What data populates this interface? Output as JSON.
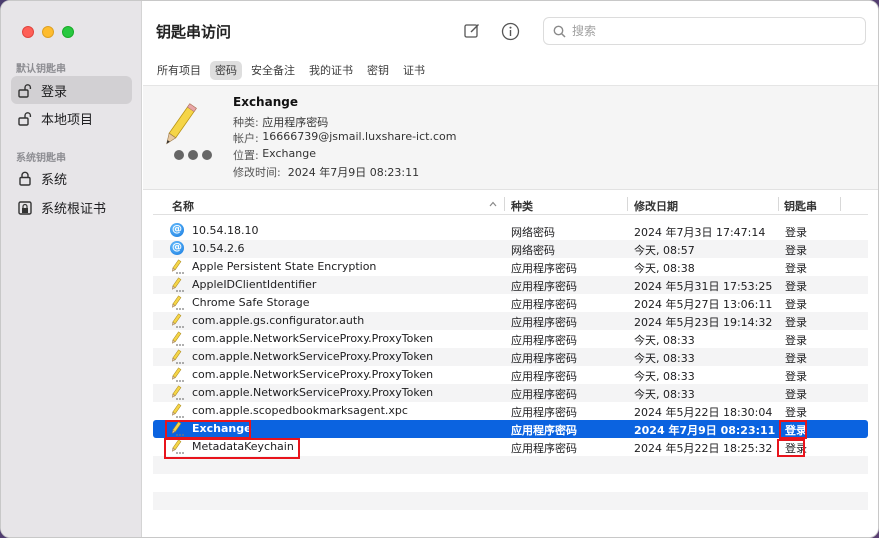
{
  "window": {
    "title": "钥匙串访问",
    "search_placeholder": "搜索"
  },
  "sidebar": {
    "section_default": "默认钥匙串",
    "section_system": "系统钥匙串",
    "items": [
      {
        "label": "登录",
        "icon": "unlock-icon"
      },
      {
        "label": "本地项目",
        "icon": "unlock-icon"
      },
      {
        "label": "系统",
        "icon": "lock-icon"
      },
      {
        "label": "系统根证书",
        "icon": "certificate-lock-icon"
      }
    ]
  },
  "tabs": [
    "所有项目",
    "密码",
    "安全备注",
    "我的证书",
    "密钥",
    "证书"
  ],
  "detail": {
    "name": "Exchange",
    "kind_label": "种类:",
    "kind": "应用程序密码",
    "account_label": "帐户:",
    "account": "16666739@jsmail.luxshare-ict.com",
    "where_label": "位置:",
    "where": "Exchange",
    "modified_label": "修改时间:",
    "modified": "2024 年7月9日 08:23:11"
  },
  "columns": {
    "name": "名称",
    "kind": "种类",
    "date": "修改日期",
    "keychain": "钥匙串"
  },
  "rows": [
    {
      "icon": "at-icon",
      "name": "10.54.18.10",
      "kind": "网络密码",
      "date": "2024 年7月3日 17:47:14",
      "keychain": "登录"
    },
    {
      "icon": "at-icon",
      "name": "10.54.2.6",
      "kind": "网络密码",
      "date": "今天, 08:57",
      "keychain": "登录"
    },
    {
      "icon": "pencil-icon",
      "name": "Apple Persistent State Encryption",
      "kind": "应用程序密码",
      "date": "今天, 08:38",
      "keychain": "登录"
    },
    {
      "icon": "pencil-icon",
      "name": "AppleIDClientIdentifier",
      "kind": "应用程序密码",
      "date": "2024 年5月31日 17:53:25",
      "keychain": "登录"
    },
    {
      "icon": "pencil-icon",
      "name": "Chrome Safe Storage",
      "kind": "应用程序密码",
      "date": "2024 年5月27日 13:06:11",
      "keychain": "登录"
    },
    {
      "icon": "pencil-icon",
      "name": "com.apple.gs.configurator.auth",
      "kind": "应用程序密码",
      "date": "2024 年5月23日 19:14:32",
      "keychain": "登录"
    },
    {
      "icon": "pencil-icon",
      "name": "com.apple.NetworkServiceProxy.ProxyToken",
      "kind": "应用程序密码",
      "date": "今天, 08:33",
      "keychain": "登录"
    },
    {
      "icon": "pencil-icon",
      "name": "com.apple.NetworkServiceProxy.ProxyToken",
      "kind": "应用程序密码",
      "date": "今天, 08:33",
      "keychain": "登录"
    },
    {
      "icon": "pencil-icon",
      "name": "com.apple.NetworkServiceProxy.ProxyToken",
      "kind": "应用程序密码",
      "date": "今天, 08:33",
      "keychain": "登录"
    },
    {
      "icon": "pencil-icon",
      "name": "com.apple.NetworkServiceProxy.ProxyToken",
      "kind": "应用程序密码",
      "date": "今天, 08:33",
      "keychain": "登录"
    },
    {
      "icon": "pencil-icon",
      "name": "com.apple.scopedbookmarksagent.xpc",
      "kind": "应用程序密码",
      "date": "2024 年5月22日 18:30:04",
      "keychain": "登录"
    },
    {
      "icon": "pencil-icon",
      "name": "Exchange",
      "kind": "应用程序密码",
      "date": "2024 年7月9日 08:23:11",
      "keychain": "登录",
      "selected": true
    },
    {
      "icon": "pencil-icon",
      "name": "MetadataKeychain",
      "kind": "应用程序密码",
      "date": "2024 年5月22日 18:25:32",
      "keychain": "登录"
    }
  ],
  "colors": {
    "selection": "#0b63e0",
    "annotation": "#e8141c"
  }
}
